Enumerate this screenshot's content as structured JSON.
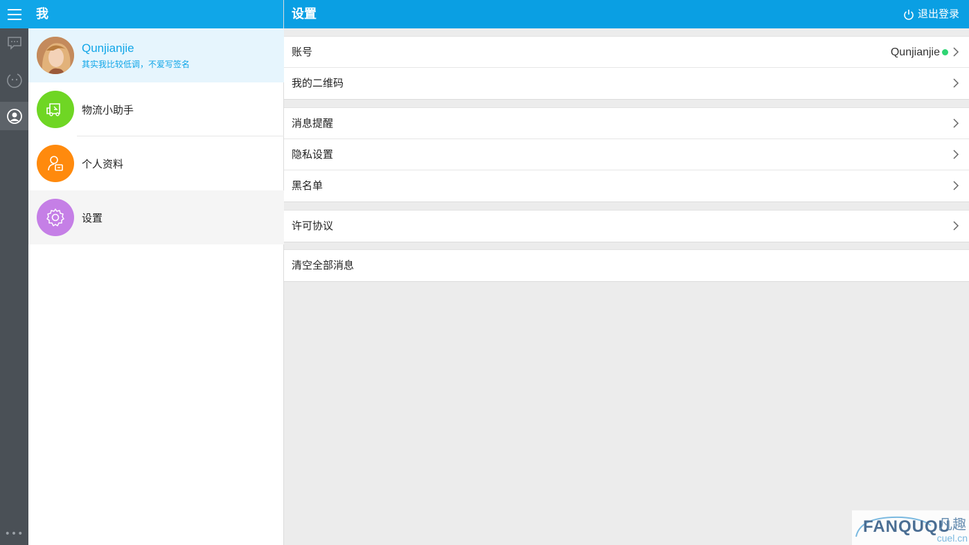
{
  "rail": {
    "more_label": "•••"
  },
  "mid": {
    "header_title": "我",
    "profile": {
      "name": "Qunjianjie",
      "signature": "其实我比较低调，不爱写签名"
    },
    "items": [
      {
        "label": "物流小助手",
        "icon": "truck-icon",
        "color": "#6fd624"
      },
      {
        "label": "个人资料",
        "icon": "profile-card-icon",
        "color": "#ff8a0d"
      },
      {
        "label": "设置",
        "icon": "gear-icon",
        "color": "#c57fe6"
      }
    ]
  },
  "right": {
    "header_title": "设置",
    "logout_label": "退出登录",
    "groups": [
      {
        "rows": [
          {
            "label": "账号",
            "value": "Qunjianjie",
            "status_color": "#2ed573"
          },
          {
            "label": "我的二维码"
          }
        ]
      },
      {
        "rows": [
          {
            "label": "消息提醒"
          },
          {
            "label": "隐私设置"
          },
          {
            "label": "黑名单"
          }
        ]
      },
      {
        "rows": [
          {
            "label": "许可协议"
          }
        ]
      },
      {
        "rows": [
          {
            "label": "清空全部消息"
          }
        ]
      }
    ]
  },
  "watermark": {
    "brand": "FANQUQU",
    "cn": "凡趣",
    "domain": "cuel.cn"
  },
  "colors": {
    "accent": "#10a6e8",
    "rail": "#4a5056",
    "background": "#ececec"
  }
}
